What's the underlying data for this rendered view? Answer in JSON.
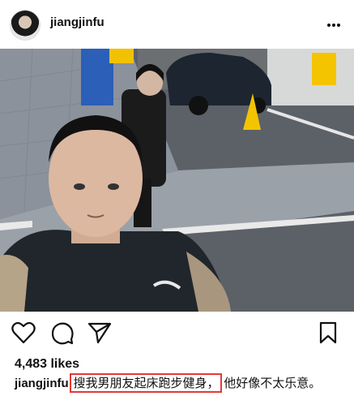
{
  "post": {
    "username": "jiangjinfu",
    "likes": "4,483 likes",
    "caption_user": "jiangjinfu",
    "caption_highlight": "搜我男朋友起床跑步健身，",
    "caption_rest": "他好像不太乐意。"
  },
  "icons": {
    "more": "more-options-icon",
    "like": "heart-icon",
    "comment": "comment-icon",
    "share": "send-icon",
    "save": "bookmark-icon"
  },
  "colors": {
    "highlight_box": "#e53935"
  }
}
